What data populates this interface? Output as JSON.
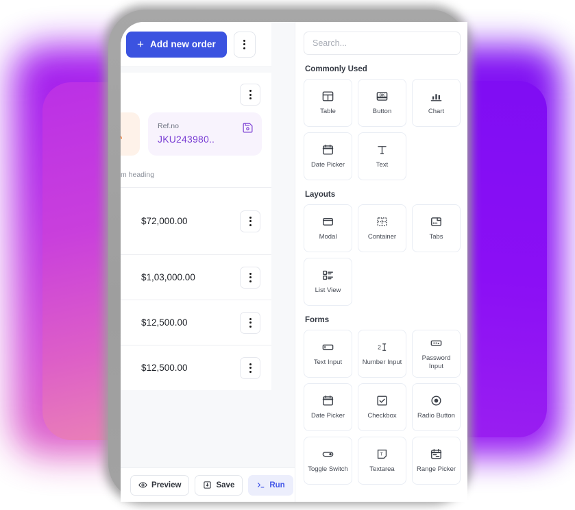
{
  "canvas": {
    "topbar": {
      "add_button": "Add new order",
      "add_icon": "plus-icon",
      "more_icon": "kebab-menu-icon"
    },
    "card_more_icon": "kebab-menu-icon",
    "stat_orange_icon": "user-group-icon",
    "ref_card": {
      "label": "Ref.no",
      "value": "JKU243980..",
      "icon": "save-floppy-icon"
    },
    "section_heading": "m heading",
    "list": [
      {
        "amount": "$72,000.00",
        "more_icon": "kebab-menu-icon"
      },
      {
        "amount": "$1,03,000.00",
        "more_icon": "kebab-menu-icon"
      },
      {
        "amount": "$12,500.00",
        "more_icon": "kebab-menu-icon"
      },
      {
        "amount": "$12,500.00",
        "more_icon": "kebab-menu-icon"
      }
    ],
    "bottombar": {
      "preview": "Preview",
      "preview_icon": "eye-icon",
      "save": "Save",
      "save_icon": "save-icon",
      "run": "Run",
      "run_icon": "terminal-prompt-icon",
      "expand_icon": "collapse-vertical-icon"
    }
  },
  "panel": {
    "search_placeholder": "Search...",
    "search_value": "",
    "groups": [
      {
        "title": "Commonly Used",
        "widgets": [
          {
            "label": "Table",
            "icon": "table-icon"
          },
          {
            "label": "Button",
            "icon": "button-ok-icon"
          },
          {
            "label": "Chart",
            "icon": "chart-bar-icon"
          },
          {
            "label": "Date Picker",
            "icon": "calendar-icon"
          },
          {
            "label": "Text",
            "icon": "text-t-icon"
          }
        ]
      },
      {
        "title": "Layouts",
        "widgets": [
          {
            "label": "Modal",
            "icon": "modal-window-icon"
          },
          {
            "label": "Container",
            "icon": "container-dashed-icon"
          },
          {
            "label": "Tabs",
            "icon": "tabs-icon"
          },
          {
            "label": "List View",
            "icon": "list-view-icon"
          }
        ]
      },
      {
        "title": "Forms",
        "widgets": [
          {
            "label": "Text Input",
            "icon": "text-input-icon"
          },
          {
            "label": "Number Input",
            "icon": "number-input-icon"
          },
          {
            "label": "Password Input",
            "icon": "password-input-icon"
          },
          {
            "label": "Date Picker",
            "icon": "calendar-icon"
          },
          {
            "label": "Checkbox",
            "icon": "checkbox-checked-icon"
          },
          {
            "label": "Radio Button",
            "icon": "radio-button-icon"
          },
          {
            "label": "Toggle Switch",
            "icon": "toggle-switch-icon"
          },
          {
            "label": "Textarea",
            "icon": "textarea-icon"
          },
          {
            "label": "Range Picker",
            "icon": "range-picker-icon"
          }
        ]
      }
    ]
  },
  "colors": {
    "primary_blue": "#3b53e0",
    "run_accent": "#4458e8",
    "ref_purple": "#7b3fd4",
    "glow_magenta": "#cf49d8",
    "glow_purple": "#8a0ef5",
    "bezel_gray": "#9e9e9e"
  }
}
